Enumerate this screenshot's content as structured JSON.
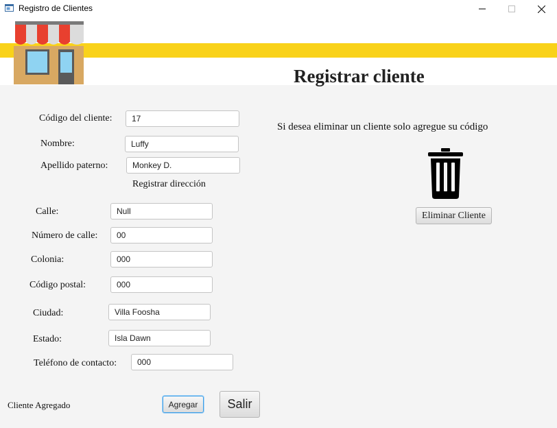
{
  "window": {
    "title": "Registro de Clientes",
    "icon": "window-app-icon"
  },
  "header": {
    "title": "Registrar cliente",
    "icon": "store-icon",
    "colors": {
      "band": "#f9d21a",
      "awning_red": "#e8402f",
      "awning_gray": "#dcdcdc",
      "building": "#d8a862"
    }
  },
  "form": {
    "codigo": {
      "label": "Código del cliente:",
      "value": "17"
    },
    "nombre": {
      "label": "Nombre:",
      "value": "Luffy"
    },
    "apellido": {
      "label": "Apellido paterno:",
      "value": "Monkey D."
    },
    "section_direccion": "Registrar dirección",
    "calle": {
      "label": "Calle:",
      "value": "Null"
    },
    "numero": {
      "label": "Número de calle:",
      "value": "00"
    },
    "colonia": {
      "label": "Colonia:",
      "value": "000"
    },
    "codigo_postal": {
      "label": "Código postal:",
      "value": "000"
    },
    "ciudad": {
      "label": "Ciudad:",
      "value": "Villa Foosha"
    },
    "estado": {
      "label": "Estado:",
      "value": "Isla Dawn"
    },
    "telefono": {
      "label": "Teléfono de contacto:",
      "value": "000"
    }
  },
  "delete": {
    "instruction": "Si desea eliminar un cliente solo agregue su código",
    "icon": "trash-icon",
    "button_label": "Eliminar Cliente"
  },
  "footer": {
    "status": "Cliente Agregado",
    "add_label": "Agregar",
    "exit_label": "Salir"
  }
}
